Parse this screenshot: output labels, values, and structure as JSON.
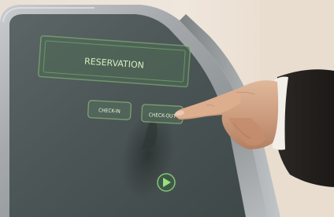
{
  "kiosk": {
    "header_label": "RESERVATION",
    "buttons": [
      {
        "label": "CHECK-IN"
      },
      {
        "label": "CHECK-OUT"
      }
    ],
    "next_icon": "play-arrow-icon"
  }
}
